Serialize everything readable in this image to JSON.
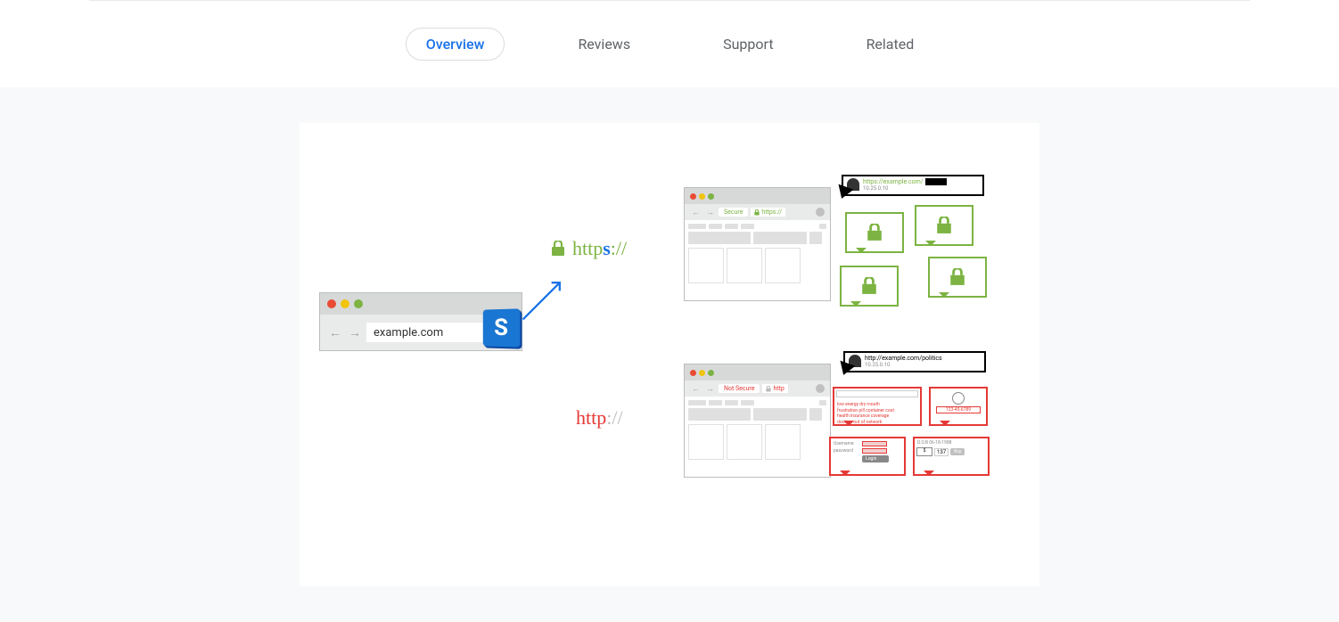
{
  "tabs": {
    "overview": "Overview",
    "reviews": "Reviews",
    "support": "Support",
    "related": "Related"
  },
  "illustration": {
    "source_url": "example.com",
    "badge_letter": "S",
    "https_label_prefix": "http",
    "https_label_s": "s",
    "https_label_suffix": "://",
    "http_label_prefix": "http",
    "http_label_suffix": "://",
    "secure_badge": "Secure",
    "secure_proto": "https://",
    "insecure_badge": "Not Secure",
    "insecure_proto": "http",
    "tooltip_secure": {
      "url": "https://example.com/",
      "ip": "10.25.0.10"
    },
    "tooltip_insecure": {
      "url": "http://example.com/politics",
      "ip": "10.25.0.10"
    },
    "leak_text": {
      "l1": "low energy dry mouth",
      "l2": "frustration pill container cost",
      "l3": "health insurance coverage",
      "l4": "doctors out of network"
    },
    "ssn": "123-45-6789",
    "login_user": "Username",
    "login_pass": "password",
    "login_btn": "Login",
    "buy_btn": "Buy",
    "qty_val": "137",
    "dob": "D.O.B 06-18-1988"
  }
}
